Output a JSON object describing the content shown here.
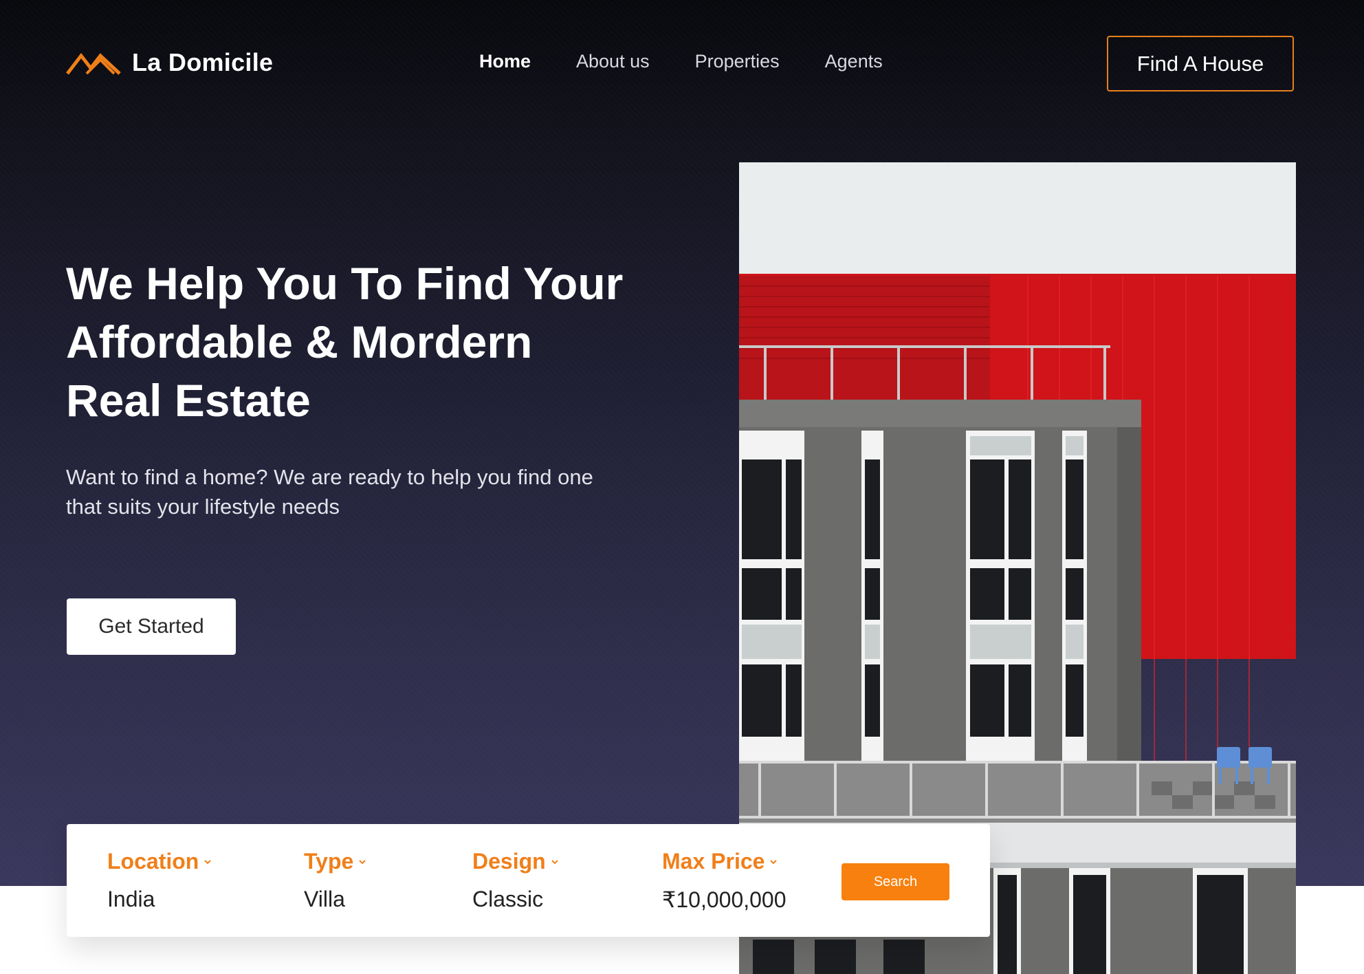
{
  "brand": {
    "name": "La Domicile",
    "accent": "#F07F1A"
  },
  "nav": {
    "items": [
      {
        "label": "Home",
        "active": true
      },
      {
        "label": "About us",
        "active": false
      },
      {
        "label": "Properties",
        "active": false
      },
      {
        "label": "Agents",
        "active": false
      }
    ],
    "cta_label": "Find A House"
  },
  "hero": {
    "headline": "We  Help You To Find Your\nAffordable & Mordern\nReal Estate",
    "subtext": "Want to find a home? We are ready to help you find one that suits your lifestyle needs",
    "cta_label": "Get Started",
    "image": "modern-building-red-facade"
  },
  "search": {
    "fields": [
      {
        "label": "Location",
        "value": "India"
      },
      {
        "label": "Type",
        "value": "Villa"
      },
      {
        "label": "Design",
        "value": "Classic"
      },
      {
        "label": "Max Price",
        "value": "₹10,000,000"
      }
    ],
    "button_label": "Search",
    "icons": {
      "dropdown": "chevron-down-icon"
    }
  }
}
